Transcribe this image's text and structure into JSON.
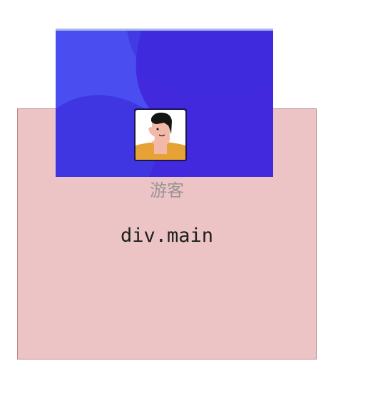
{
  "header": {
    "avatar_icon": "user-avatar-icon",
    "colors": {
      "background": "#4329de",
      "top_border": "#a9b8ea"
    }
  },
  "main": {
    "guest_label": "游客",
    "label": "div.main",
    "colors": {
      "background": "#ecc4c6",
      "border": "#b98588"
    }
  }
}
